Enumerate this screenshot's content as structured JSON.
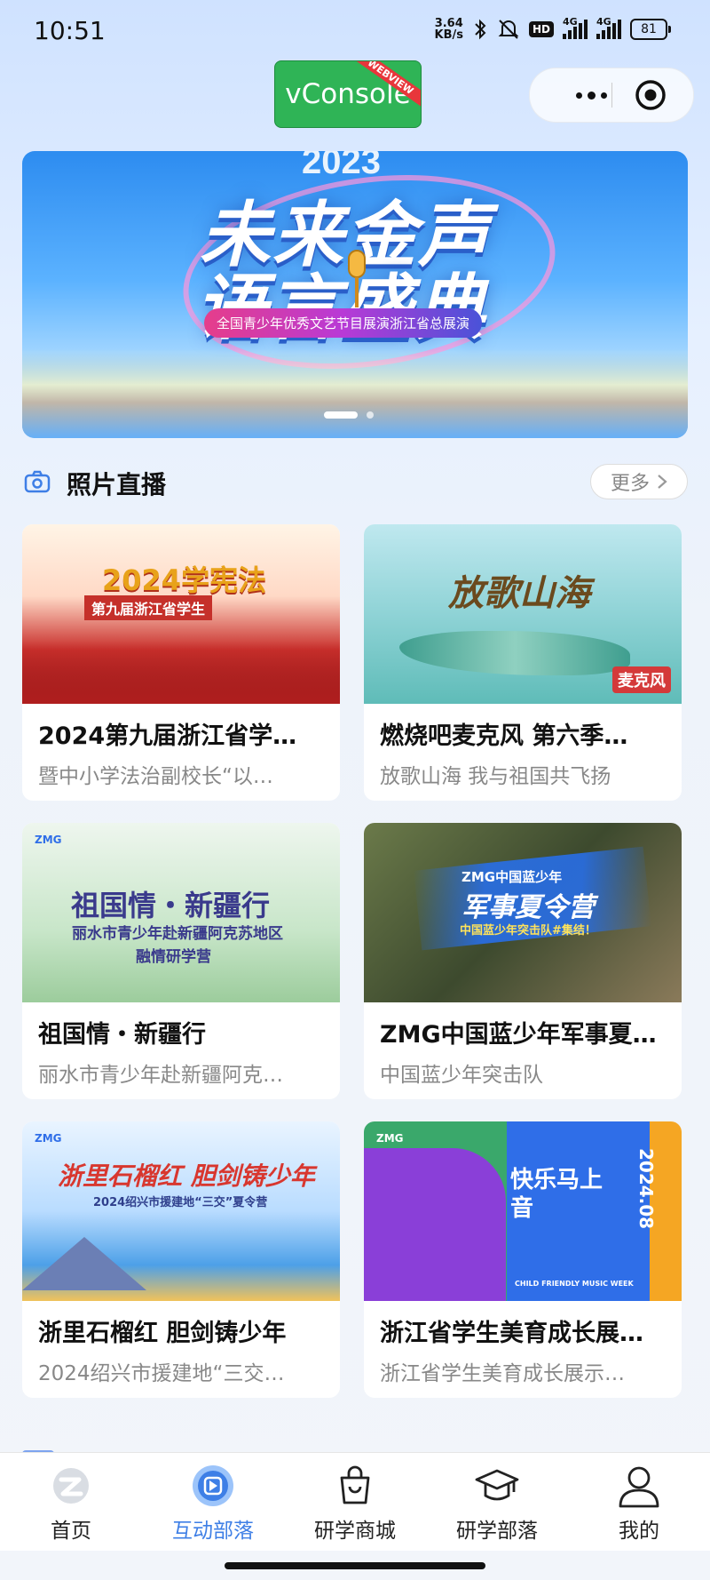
{
  "status_bar": {
    "time": "10:51",
    "speed_value": "3.64",
    "speed_unit": "KB/s",
    "hd_label": "HD",
    "network1": "4G",
    "network2": "4G",
    "battery": "81"
  },
  "vconsole": {
    "label": "vConsole",
    "ribbon": "WEBVIEW"
  },
  "banner": {
    "year": "2023",
    "title_line1": "未来金声",
    "title_line2": "语言盛典",
    "subtitle": "全国青少年优秀文艺节目展演浙江省总展演",
    "slide_count": 2,
    "active_slide": 1
  },
  "section": {
    "icon": "camera-icon",
    "title": "照片直播",
    "more_label": "更多"
  },
  "cards": [
    {
      "title": "2024第九届浙江省学…",
      "subtitle": "暨中小学法治副校长“以…",
      "thumb_line1": "2024学宪法",
      "thumb_line2": "第九届浙江省学生"
    },
    {
      "title": "燃烧吧麦克风 第六季…",
      "subtitle": "放歌山海 我与祖国共飞扬",
      "thumb_line1": "放歌山海",
      "thumb_line2": "麦克风"
    },
    {
      "title": "祖国情・新疆行",
      "subtitle": "丽水市青少年赴新疆阿克…",
      "thumb_line1": "祖国情・新疆行",
      "thumb_line2": "丽水市青少年赴新疆阿克苏地区",
      "thumb_line3": "融情研学营",
      "thumb_brand": "ZMG"
    },
    {
      "title": "ZMG中国蓝少年军事夏…",
      "subtitle": "中国蓝少年突击队",
      "thumb_line1": "军事夏令营",
      "thumb_line2": "中国蓝少年突击队#集结！",
      "thumb_brand": "ZMG中国蓝少年"
    },
    {
      "title": "浙里石榴红 胆剑铸少年",
      "subtitle": "2024绍兴市援建地“三交…",
      "thumb_line1": "浙里石榴红 胆剑铸少年",
      "thumb_line2": "2024绍兴市援建地“三交”夏令营",
      "thumb_brand": "ZMG"
    },
    {
      "title": "浙江省学生美育成长展…",
      "subtitle": "浙江省学生美育成长展示…",
      "thumb_line1": "快乐马上音",
      "thumb_line2": "2024.08",
      "thumb_line3": "CHILD FRIENDLY MUSIC WEEK",
      "thumb_brand": "ZMG"
    }
  ],
  "tabbar": {
    "items": [
      {
        "label": "首页",
        "icon": "home-logo-icon"
      },
      {
        "label": "互动部落",
        "icon": "play-circle-icon",
        "active": true
      },
      {
        "label": "研学商城",
        "icon": "shopping-bag-icon"
      },
      {
        "label": "研学部落",
        "icon": "graduation-cap-icon"
      },
      {
        "label": "我的",
        "icon": "user-icon"
      }
    ]
  },
  "colors": {
    "accent": "#3e7fe6",
    "vconsole_green": "#2fb456",
    "ribbon_red": "#e8363b"
  }
}
